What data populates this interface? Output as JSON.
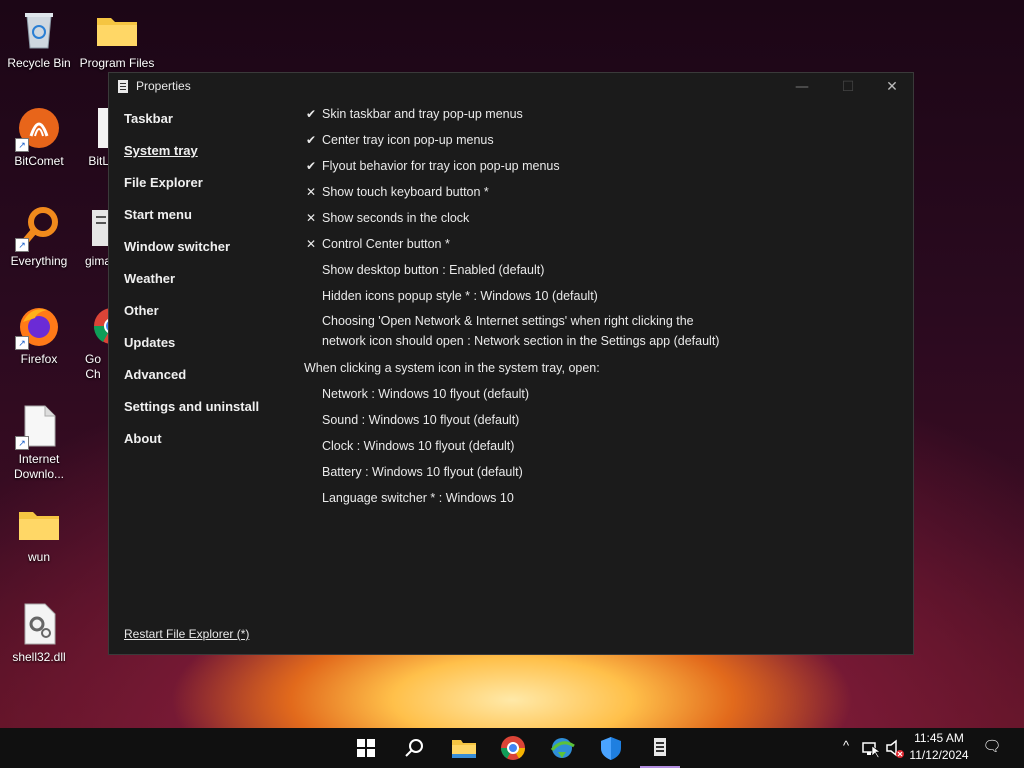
{
  "desktop": {
    "icons": [
      {
        "label": "Recycle Bin"
      },
      {
        "label": "Program Files"
      },
      {
        "label": "BitComet"
      },
      {
        "label": "BitLo"
      },
      {
        "label": "Everything"
      },
      {
        "label": "gima"
      },
      {
        "label": "Firefox"
      },
      {
        "label": "Go Ch"
      },
      {
        "label": "Internet Downlo..."
      },
      {
        "label": "wun"
      },
      {
        "label": "shell32.dll"
      }
    ]
  },
  "window": {
    "title": "Properties",
    "controls": {
      "minimize": "—",
      "maximize": "☐",
      "close": "✕"
    },
    "nav": [
      {
        "label": "Taskbar",
        "active": false
      },
      {
        "label": "System tray",
        "active": true
      },
      {
        "label": "File Explorer",
        "active": false
      },
      {
        "label": "Start menu",
        "active": false
      },
      {
        "label": "Window switcher",
        "active": false
      },
      {
        "label": "Weather",
        "active": false
      },
      {
        "label": "Other",
        "active": false
      },
      {
        "label": "Updates",
        "active": false
      },
      {
        "label": "Advanced",
        "active": false
      },
      {
        "label": "Settings and uninstall",
        "active": false
      },
      {
        "label": "About",
        "active": false
      }
    ],
    "settings": [
      {
        "mark": "✔",
        "text": "Skin taskbar and tray pop-up menus"
      },
      {
        "mark": "✔",
        "text": "Center tray icon pop-up menus"
      },
      {
        "mark": "✔",
        "text": "Flyout behavior for tray icon pop-up menus"
      },
      {
        "mark": "✕",
        "text": "Show touch keyboard button *"
      },
      {
        "mark": "✕",
        "text": "Show seconds in the clock"
      },
      {
        "mark": "✕",
        "text": "Control Center button *"
      },
      {
        "mark": "",
        "text": "Show desktop button : Enabled (default)"
      },
      {
        "mark": "",
        "text": "Hidden icons popup style * : Windows 10 (default)"
      },
      {
        "mark": "",
        "text": "Choosing 'Open Network & Internet settings' when right clicking the network icon should open : Network section in the Settings app (default)"
      }
    ],
    "section_heading": "When clicking a system icon in the system tray, open:",
    "sub_settings": [
      {
        "text": "Network : Windows 10 flyout (default)"
      },
      {
        "text": "Sound : Windows 10 flyout (default)"
      },
      {
        "text": "Clock : Windows 10 flyout (default)"
      },
      {
        "text": "Battery : Windows 10 flyout (default)"
      },
      {
        "text": "Language switcher * : Windows 10"
      }
    ],
    "restart_link": "Restart File Explorer (*)"
  },
  "taskbar": {
    "clock": {
      "time": "11:45 AM",
      "date": "11/12/2024"
    },
    "tray_chevron": "^",
    "notification_glyph": "🗨"
  },
  "colors": {
    "window_bg": "#1b1b1b",
    "taskbar_bg": "#101010",
    "accent_running": "#b38ee0"
  }
}
